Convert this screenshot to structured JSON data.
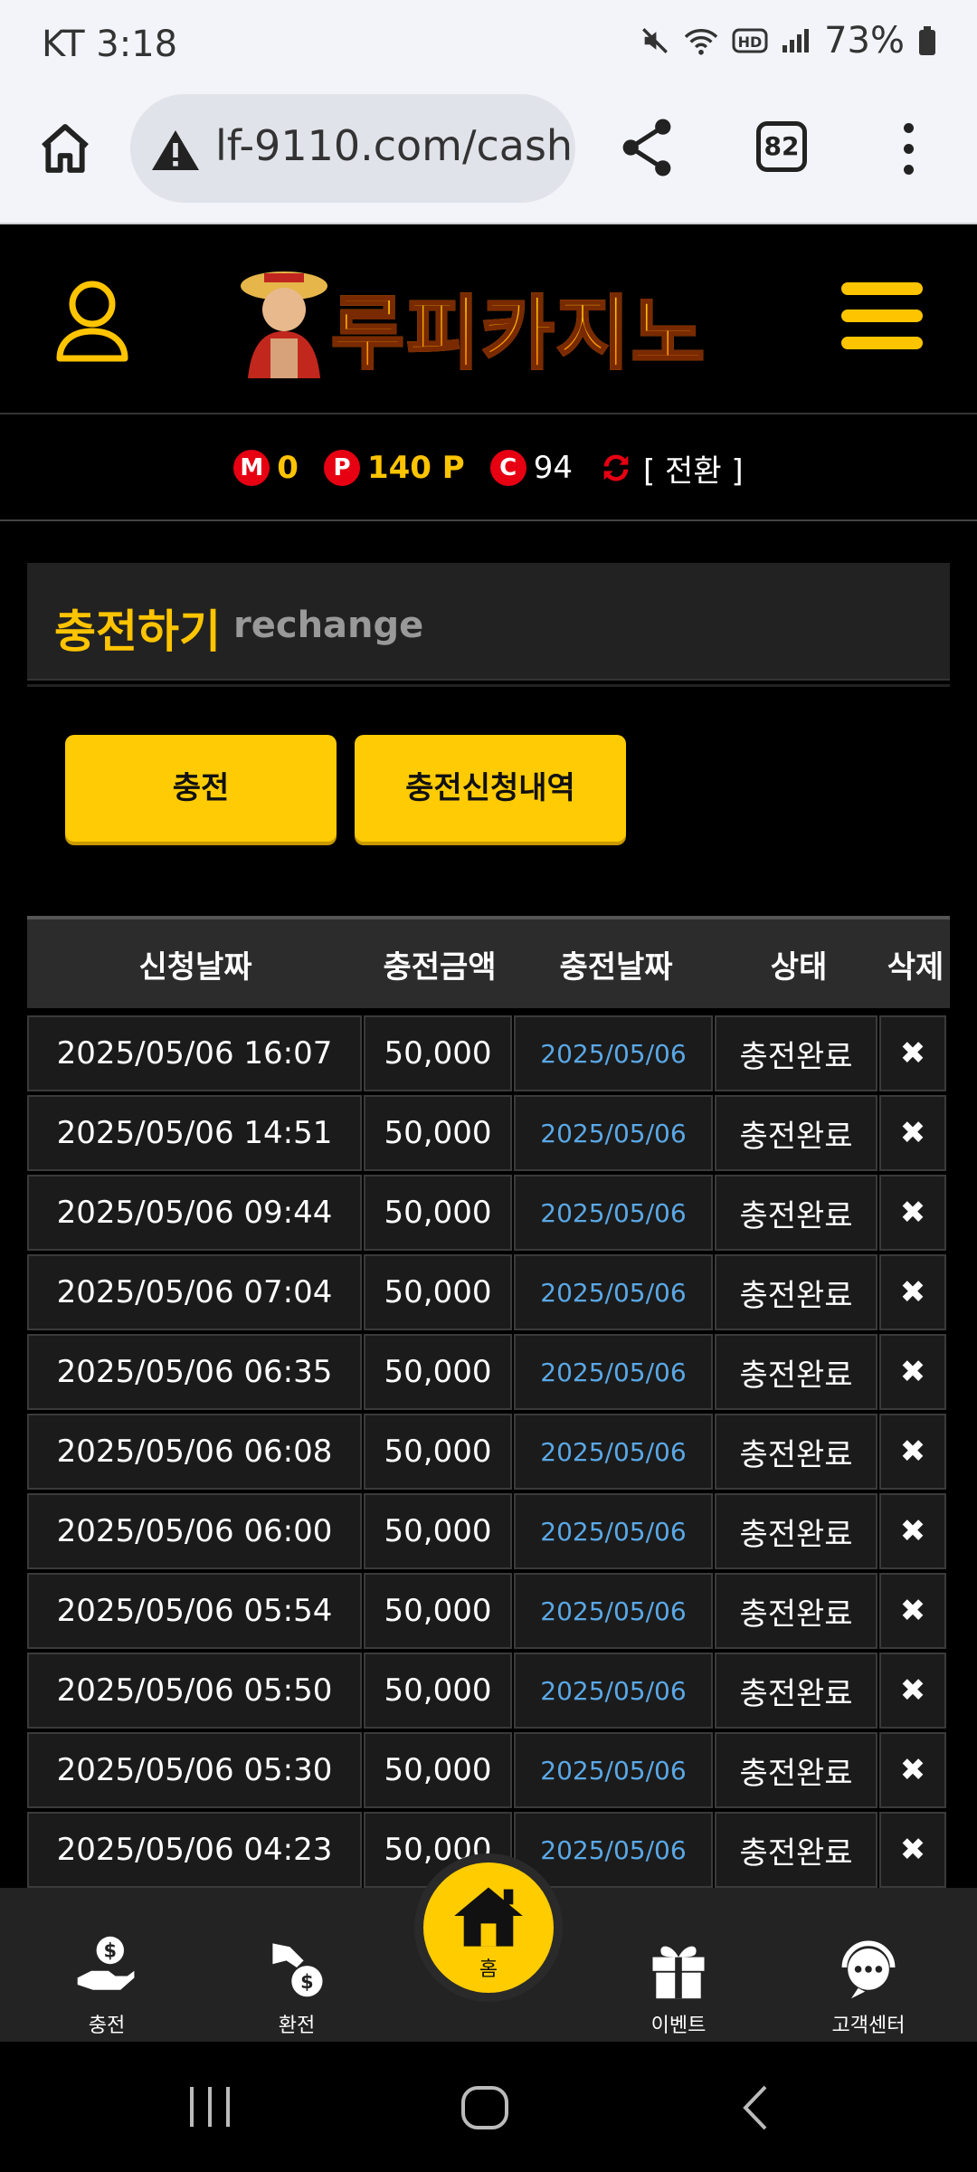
{
  "status_bar": {
    "carrier_time": "KT 3:18",
    "battery": "73%"
  },
  "browser": {
    "url": "lf-9110.com/cash_",
    "tab_count": "82"
  },
  "site": {
    "logo_text": "루피카지노"
  },
  "balance": {
    "m_badge": "M",
    "m_value": "0",
    "p_badge": "P",
    "p_value": "140 P",
    "c_badge": "C",
    "c_value": "94",
    "convert_label": "[ 전환 ]"
  },
  "section": {
    "title_ko": "충전하기",
    "title_en": "rechange"
  },
  "buttons": {
    "charge": "충전",
    "history": "충전신청내역"
  },
  "table": {
    "headers": [
      "신청날짜",
      "충전금액",
      "충전날짜",
      "상태",
      "삭제"
    ],
    "rows": [
      [
        "2025/05/06 16:07",
        "50,000",
        "2025/05/06",
        "충전완료",
        "✖"
      ],
      [
        "2025/05/06 14:51",
        "50,000",
        "2025/05/06",
        "충전완료",
        "✖"
      ],
      [
        "2025/05/06 09:44",
        "50,000",
        "2025/05/06",
        "충전완료",
        "✖"
      ],
      [
        "2025/05/06 07:04",
        "50,000",
        "2025/05/06",
        "충전완료",
        "✖"
      ],
      [
        "2025/05/06 06:35",
        "50,000",
        "2025/05/06",
        "충전완료",
        "✖"
      ],
      [
        "2025/05/06 06:08",
        "50,000",
        "2025/05/06",
        "충전완료",
        "✖"
      ],
      [
        "2025/05/06 06:00",
        "50,000",
        "2025/05/06",
        "충전완료",
        "✖"
      ],
      [
        "2025/05/06 05:54",
        "50,000",
        "2025/05/06",
        "충전완료",
        "✖"
      ],
      [
        "2025/05/06 05:50",
        "50,000",
        "2025/05/06",
        "충전완료",
        "✖"
      ],
      [
        "2025/05/06 05:30",
        "50,000",
        "2025/05/06",
        "충전완료",
        "✖"
      ],
      [
        "2025/05/06 04:23",
        "50,000",
        "2025/05/06",
        "충전완료",
        "✖"
      ]
    ]
  },
  "bottom_nav": {
    "charge": "충전",
    "exchange": "환전",
    "home": "홈",
    "event": "이벤트",
    "support": "고객센터"
  },
  "colors": {
    "accent": "#ffcb05",
    "link_blue": "#5aa8e6",
    "badge_red": "#e60012"
  }
}
